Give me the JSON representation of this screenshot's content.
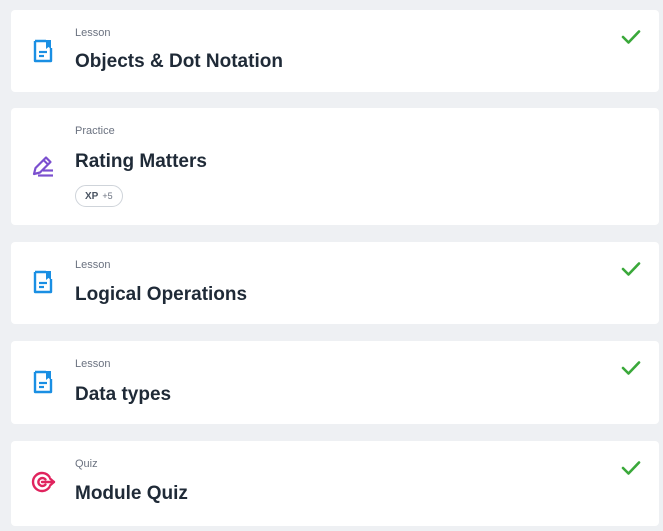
{
  "colors": {
    "background": "#eef0f3",
    "card": "#ffffff",
    "lesson_icon": "#1a8fe3",
    "practice_icon": "#7b4fcf",
    "quiz_icon": "#e0245e",
    "check": "#3aa83a",
    "title": "#1f2a37",
    "label": "#6b7280"
  },
  "items": [
    {
      "type": "Lesson",
      "title": "Objects & Dot Notation",
      "icon": "lesson-document-icon",
      "completed": true
    },
    {
      "type": "Practice",
      "title": "Rating Matters",
      "icon": "pencil-lines-icon",
      "completed": false,
      "xp": {
        "label": "XP",
        "value": "+5"
      }
    },
    {
      "type": "Lesson",
      "title": "Logical Operations",
      "icon": "lesson-document-icon",
      "completed": true
    },
    {
      "type": "Lesson",
      "title": "Data types",
      "icon": "lesson-document-icon",
      "completed": true
    },
    {
      "type": "Quiz",
      "title": "Module Quiz",
      "icon": "target-arrow-icon",
      "completed": true
    }
  ]
}
